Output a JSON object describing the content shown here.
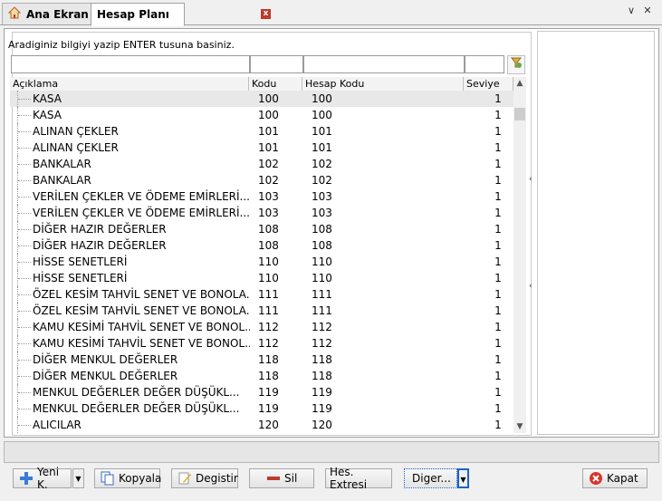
{
  "tabs": [
    {
      "label": "Ana Ekran",
      "icon": "home-icon"
    },
    {
      "label": "Hesap Planı",
      "icon": "close-icon"
    }
  ],
  "search": {
    "hint": "Aradiginiz bilgiyi yazip ENTER tusuna basiniz."
  },
  "grid": {
    "columns": [
      "Açıklama",
      "Kodu",
      "Hesap Kodu",
      "Seviye"
    ],
    "rows": [
      [
        "KASA",
        "100",
        "100",
        "1"
      ],
      [
        "KASA",
        "100",
        "100",
        "1"
      ],
      [
        "ALINAN ÇEKLER",
        "101",
        "101",
        "1"
      ],
      [
        "ALINAN ÇEKLER",
        "101",
        "101",
        "1"
      ],
      [
        "BANKALAR",
        "102",
        "102",
        "1"
      ],
      [
        "BANKALAR",
        "102",
        "102",
        "1"
      ],
      [
        "VERİLEN ÇEKLER VE ÖDEME EMİRLERİ...",
        "103",
        "103",
        "1"
      ],
      [
        "VERİLEN ÇEKLER VE ÖDEME EMİRLERİ...",
        "103",
        "103",
        "1"
      ],
      [
        "DİĞER HAZIR DEĞERLER",
        "108",
        "108",
        "1"
      ],
      [
        "DİĞER HAZIR DEĞERLER",
        "108",
        "108",
        "1"
      ],
      [
        "HİSSE SENETLERİ",
        "110",
        "110",
        "1"
      ],
      [
        "HİSSE SENETLERİ",
        "110",
        "110",
        "1"
      ],
      [
        "ÖZEL KESİM TAHVİL SENET VE BONOLA...",
        "111",
        "111",
        "1"
      ],
      [
        "ÖZEL KESİM TAHVİL SENET VE BONOLA...",
        "111",
        "111",
        "1"
      ],
      [
        "KAMU KESİMİ TAHVİL SENET VE BONOL...",
        "112",
        "112",
        "1"
      ],
      [
        "KAMU KESİMİ TAHVİL SENET VE BONOL...",
        "112",
        "112",
        "1"
      ],
      [
        "DİĞER MENKUL DEĞERLER",
        "118",
        "118",
        "1"
      ],
      [
        "DİĞER MENKUL DEĞERLER",
        "118",
        "118",
        "1"
      ],
      [
        "MENKUL DEĞERLER DEĞER DÜŞÜKL...",
        "119",
        "119",
        "1"
      ],
      [
        "MENKUL DEĞERLER DEĞER DÜŞÜKL...",
        "119",
        "119",
        "1"
      ],
      [
        "ALICILAR",
        "120",
        "120",
        "1"
      ]
    ]
  },
  "buttons": {
    "yeni": "Yeni K.",
    "kopyala": "Kopyala",
    "degistir": "Degistir",
    "sil": "Sil",
    "hes_extresi": "Hes. Extresi",
    "diger": "Diger...",
    "kapat": "Kapat"
  },
  "colors": {
    "selected_row": "#e8e8e8",
    "focus_border": "#1e63c8",
    "close_red": "#c0392b"
  }
}
